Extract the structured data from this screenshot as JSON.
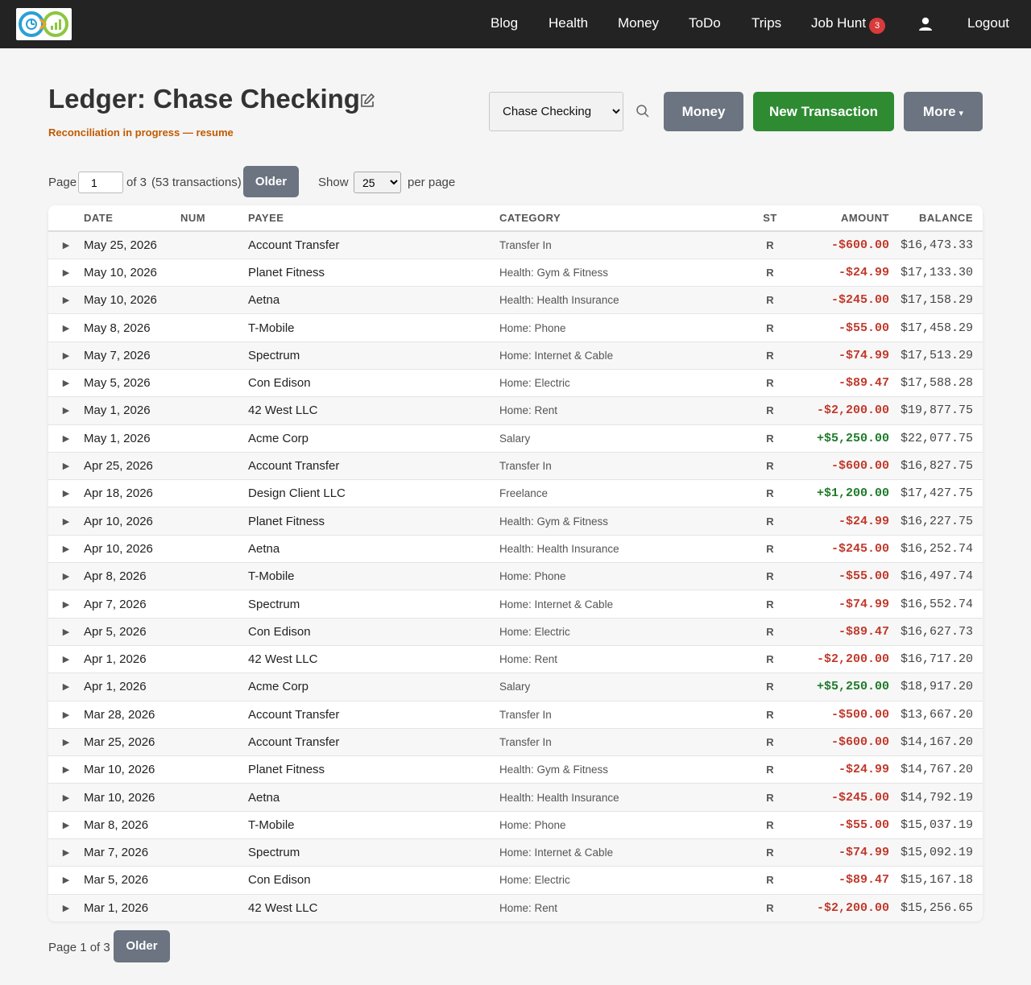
{
  "nav": {
    "logo_alt": "logo-icon",
    "links": [
      {
        "label": "Blog"
      },
      {
        "label": "Health"
      },
      {
        "label": "Money"
      },
      {
        "label": "ToDo"
      },
      {
        "label": "Trips"
      },
      {
        "label": "Job Hunt",
        "badge": "3"
      },
      {
        "label": "Logout"
      }
    ],
    "badge_color": "#d93b3b"
  },
  "header": {
    "title": "Ledger: Chase Checking",
    "reconciliation": "Reconciliation in progress — resume",
    "account_selected": "Chase Checking",
    "buttons": {
      "money": "Money",
      "new_transaction": "New Transaction",
      "more": "More"
    }
  },
  "pager": {
    "page_label": "Page",
    "page_value": "1",
    "of_text": "of 3",
    "count_text": "(53 transactions)",
    "older": "Older",
    "show_label": "Show",
    "per_page_value": "25",
    "per_page_label": "per page",
    "bottom_text": "Page 1 of 3"
  },
  "table": {
    "headers": {
      "date": "DATE",
      "num": "NUM",
      "payee": "PAYEE",
      "category": "CATEGORY",
      "st": "ST",
      "amount": "AMOUNT",
      "balance": "BALANCE"
    },
    "rows": [
      {
        "date": "May 25, 2026",
        "num": "",
        "payee": "Account Transfer",
        "category": "Transfer In",
        "st": "R",
        "amount": "-$600.00",
        "balance": "$16,473.33"
      },
      {
        "date": "May 10, 2026",
        "num": "",
        "payee": "Planet Fitness",
        "category": "Health: Gym & Fitness",
        "st": "R",
        "amount": "-$24.99",
        "balance": "$17,133.30"
      },
      {
        "date": "May 10, 2026",
        "num": "",
        "payee": "Aetna",
        "category": "Health: Health Insurance",
        "st": "R",
        "amount": "-$245.00",
        "balance": "$17,158.29"
      },
      {
        "date": "May 8, 2026",
        "num": "",
        "payee": "T-Mobile",
        "category": "Home: Phone",
        "st": "R",
        "amount": "-$55.00",
        "balance": "$17,458.29"
      },
      {
        "date": "May 7, 2026",
        "num": "",
        "payee": "Spectrum",
        "category": "Home: Internet & Cable",
        "st": "R",
        "amount": "-$74.99",
        "balance": "$17,513.29"
      },
      {
        "date": "May 5, 2026",
        "num": "",
        "payee": "Con Edison",
        "category": "Home: Electric",
        "st": "R",
        "amount": "-$89.47",
        "balance": "$17,588.28"
      },
      {
        "date": "May 1, 2026",
        "num": "",
        "payee": "42 West LLC",
        "category": "Home: Rent",
        "st": "R",
        "amount": "-$2,200.00",
        "balance": "$19,877.75"
      },
      {
        "date": "May 1, 2026",
        "num": "",
        "payee": "Acme Corp",
        "category": "Salary",
        "st": "R",
        "amount": "+$5,250.00",
        "balance": "$22,077.75"
      },
      {
        "date": "Apr 25, 2026",
        "num": "",
        "payee": "Account Transfer",
        "category": "Transfer In",
        "st": "R",
        "amount": "-$600.00",
        "balance": "$16,827.75"
      },
      {
        "date": "Apr 18, 2026",
        "num": "",
        "payee": "Design Client LLC",
        "category": "Freelance",
        "st": "R",
        "amount": "+$1,200.00",
        "balance": "$17,427.75"
      },
      {
        "date": "Apr 10, 2026",
        "num": "",
        "payee": "Planet Fitness",
        "category": "Health: Gym & Fitness",
        "st": "R",
        "amount": "-$24.99",
        "balance": "$16,227.75"
      },
      {
        "date": "Apr 10, 2026",
        "num": "",
        "payee": "Aetna",
        "category": "Health: Health Insurance",
        "st": "R",
        "amount": "-$245.00",
        "balance": "$16,252.74"
      },
      {
        "date": "Apr 8, 2026",
        "num": "",
        "payee": "T-Mobile",
        "category": "Home: Phone",
        "st": "R",
        "amount": "-$55.00",
        "balance": "$16,497.74"
      },
      {
        "date": "Apr 7, 2026",
        "num": "",
        "payee": "Spectrum",
        "category": "Home: Internet & Cable",
        "st": "R",
        "amount": "-$74.99",
        "balance": "$16,552.74"
      },
      {
        "date": "Apr 5, 2026",
        "num": "",
        "payee": "Con Edison",
        "category": "Home: Electric",
        "st": "R",
        "amount": "-$89.47",
        "balance": "$16,627.73"
      },
      {
        "date": "Apr 1, 2026",
        "num": "",
        "payee": "42 West LLC",
        "category": "Home: Rent",
        "st": "R",
        "amount": "-$2,200.00",
        "balance": "$16,717.20"
      },
      {
        "date": "Apr 1, 2026",
        "num": "",
        "payee": "Acme Corp",
        "category": "Salary",
        "st": "R",
        "amount": "+$5,250.00",
        "balance": "$18,917.20"
      },
      {
        "date": "Mar 28, 2026",
        "num": "",
        "payee": "Account Transfer",
        "category": "Transfer In",
        "st": "R",
        "amount": "-$500.00",
        "balance": "$13,667.20"
      },
      {
        "date": "Mar 25, 2026",
        "num": "",
        "payee": "Account Transfer",
        "category": "Transfer In",
        "st": "R",
        "amount": "-$600.00",
        "balance": "$14,167.20"
      },
      {
        "date": "Mar 10, 2026",
        "num": "",
        "payee": "Planet Fitness",
        "category": "Health: Gym & Fitness",
        "st": "R",
        "amount": "-$24.99",
        "balance": "$14,767.20"
      },
      {
        "date": "Mar 10, 2026",
        "num": "",
        "payee": "Aetna",
        "category": "Health: Health Insurance",
        "st": "R",
        "amount": "-$245.00",
        "balance": "$14,792.19"
      },
      {
        "date": "Mar 8, 2026",
        "num": "",
        "payee": "T-Mobile",
        "category": "Home: Phone",
        "st": "R",
        "amount": "-$55.00",
        "balance": "$15,037.19"
      },
      {
        "date": "Mar 7, 2026",
        "num": "",
        "payee": "Spectrum",
        "category": "Home: Internet & Cable",
        "st": "R",
        "amount": "-$74.99",
        "balance": "$15,092.19"
      },
      {
        "date": "Mar 5, 2026",
        "num": "",
        "payee": "Con Edison",
        "category": "Home: Electric",
        "st": "R",
        "amount": "-$89.47",
        "balance": "$15,167.18"
      },
      {
        "date": "Mar 1, 2026",
        "num": "",
        "payee": "42 West LLC",
        "category": "Home: Rent",
        "st": "R",
        "amount": "-$2,200.00",
        "balance": "$15,256.65"
      }
    ]
  },
  "colors": {
    "negative": "#c0392b",
    "positive": "#1e7a2a",
    "new_button": "#2e8b32",
    "grey_button": "#6b7480",
    "reconcile": "#c05a00"
  }
}
